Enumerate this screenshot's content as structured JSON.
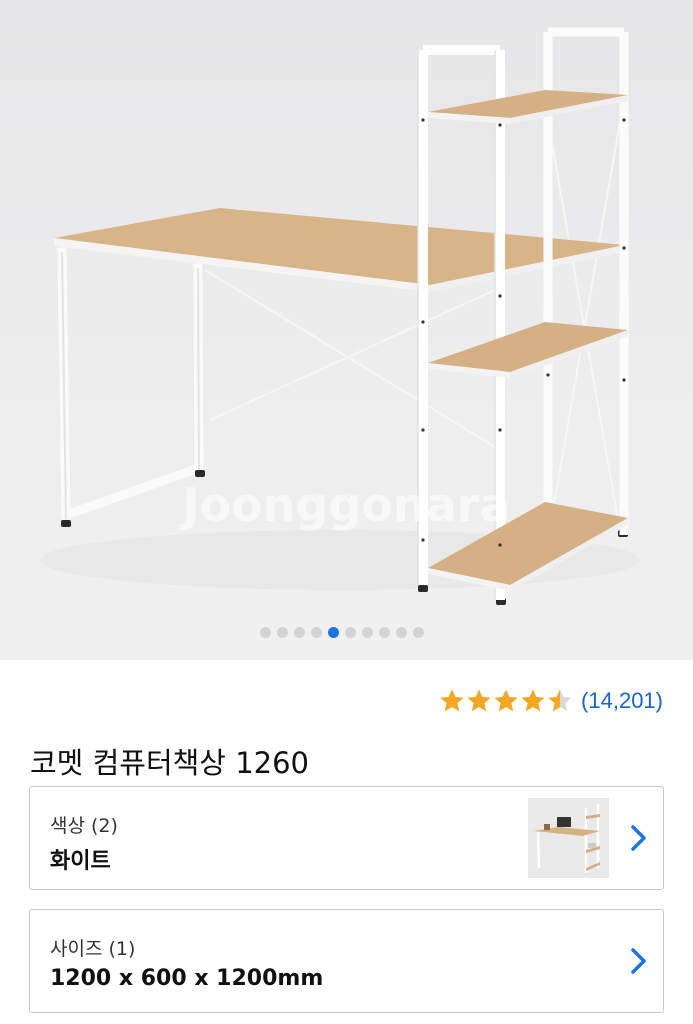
{
  "hero": {
    "watermark": "Joonggonara",
    "carousel": {
      "total": 10,
      "active_index": 4
    }
  },
  "product": {
    "rating": {
      "value": 4.5,
      "max": 5,
      "count_label": "(14,201)"
    },
    "title": "코멧 컴퓨터책상 1260"
  },
  "options": {
    "color": {
      "label": "색상 (2)",
      "value": "화이트"
    },
    "size": {
      "label": "사이즈 (1)",
      "value": "1200 x 600 x 1200mm"
    }
  },
  "colors": {
    "accent": "#1a73e8",
    "star": "#f5a623",
    "link": "#1a63c8",
    "wood": "#d6b085",
    "frame": "#ffffff"
  },
  "icons": {
    "next": "chevron-right-icon",
    "star": "star-icon"
  }
}
